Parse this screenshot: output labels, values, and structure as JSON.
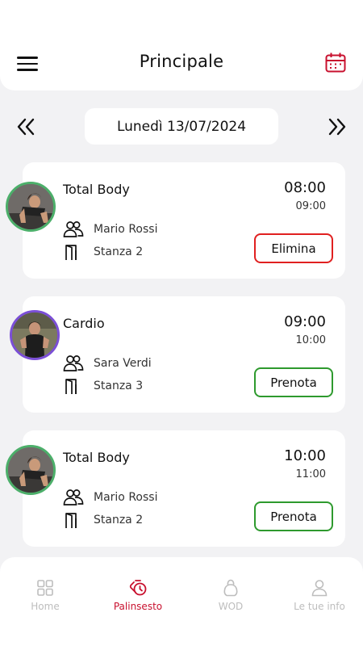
{
  "header": {
    "title": "Principale"
  },
  "date_bar": {
    "date": "Lunedì 13/07/2024"
  },
  "colors": {
    "accent": "#c8102e",
    "delete_border": "#e02020",
    "book_border": "#2e9a2e",
    "avatar_green": "#4caf6a",
    "avatar_purple": "#7b4fd6",
    "inactive_tab": "#bdbdbd"
  },
  "lessons": [
    {
      "name": "Total Body",
      "start": "08:00",
      "end": "09:00",
      "trainer": "Mario Rossi",
      "room": "Stanza 2",
      "action": "Elimina"
    },
    {
      "name": "Cardio",
      "start": "09:00",
      "end": "10:00",
      "trainer": "Sara Verdi",
      "room": "Stanza 3",
      "action": "Prenota"
    },
    {
      "name": "Total Body",
      "start": "10:00",
      "end": "11:00",
      "trainer": "Mario Rossi",
      "room": "Stanza 2",
      "action": "Prenota"
    }
  ],
  "tabbar": {
    "tabs": [
      {
        "label": "Home",
        "icon": "grid-icon",
        "active": false
      },
      {
        "label": "Palinsesto",
        "icon": "calendar-clock-icon",
        "active": true
      },
      {
        "label": "WOD",
        "icon": "kettlebell-icon",
        "active": false
      },
      {
        "label": "Le tue info",
        "icon": "user-icon",
        "active": false
      }
    ]
  }
}
